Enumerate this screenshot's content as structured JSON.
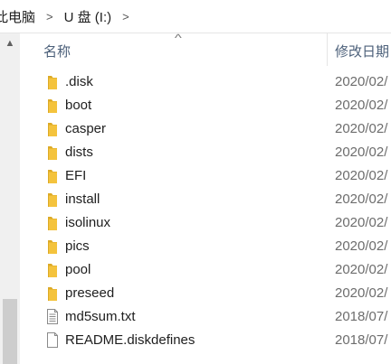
{
  "breadcrumb": {
    "items": [
      "此电脑",
      "U 盘 (I:)"
    ],
    "separator": ">"
  },
  "header": {
    "name_label": "名称",
    "date_label": "修改日期"
  },
  "files": [
    {
      "name": ".disk",
      "date": "2020/02/",
      "type": "folder"
    },
    {
      "name": "boot",
      "date": "2020/02/",
      "type": "folder"
    },
    {
      "name": "casper",
      "date": "2020/02/",
      "type": "folder"
    },
    {
      "name": "dists",
      "date": "2020/02/",
      "type": "folder"
    },
    {
      "name": "EFI",
      "date": "2020/02/",
      "type": "folder"
    },
    {
      "name": "install",
      "date": "2020/02/",
      "type": "folder"
    },
    {
      "name": "isolinux",
      "date": "2020/02/",
      "type": "folder"
    },
    {
      "name": "pics",
      "date": "2020/02/",
      "type": "folder"
    },
    {
      "name": "pool",
      "date": "2020/02/",
      "type": "folder"
    },
    {
      "name": "preseed",
      "date": "2020/02/",
      "type": "folder"
    },
    {
      "name": "md5sum.txt",
      "date": "2018/07/",
      "type": "text-file"
    },
    {
      "name": "README.diskdefines",
      "date": "2018/07/",
      "type": "file"
    }
  ],
  "colors": {
    "folder": "#f4c33d",
    "folder_dark": "#dcaa26",
    "header_text": "#4c607a"
  }
}
